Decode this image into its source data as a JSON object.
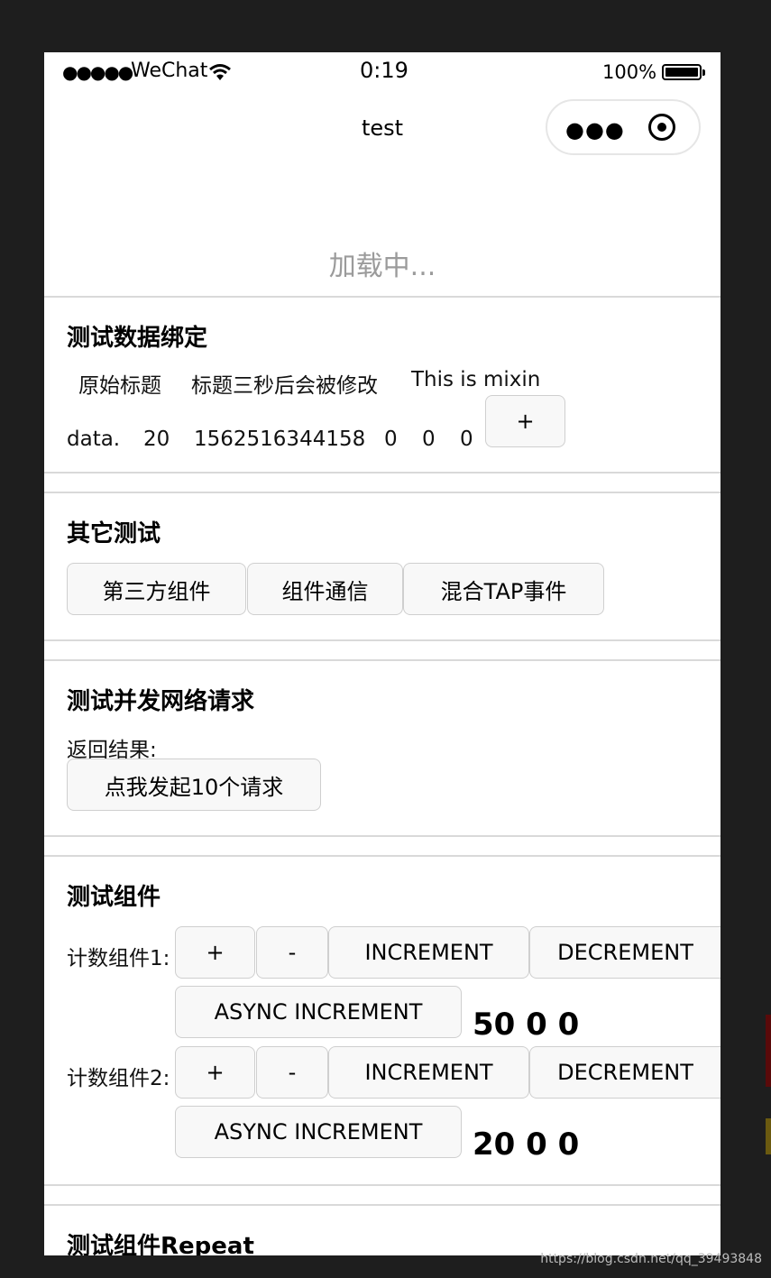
{
  "status_bar": {
    "signal": "●●●●●",
    "carrier": "WeChat",
    "time": "0:19",
    "battery": "100%"
  },
  "nav": {
    "title": "test"
  },
  "loading": {
    "text": "加载中..."
  },
  "section_binding": {
    "title": "测试数据绑定",
    "labels": [
      "原始标题",
      "标题三秒后会被修改",
      "This is mixin"
    ],
    "values": [
      "data.",
      "20",
      "1562516344158",
      "0",
      "0",
      "0"
    ],
    "plus_label": "+"
  },
  "section_other": {
    "title": "其它测试",
    "buttons": [
      "第三方组件",
      "组件通信",
      "混合TAP事件"
    ]
  },
  "section_network": {
    "title": "测试并发网络请求",
    "result_label": "返回结果:",
    "button": "点我发起10个请求"
  },
  "section_component": {
    "title": "测试组件",
    "counters": [
      {
        "label": "计数组件1:",
        "btn_plus": "+",
        "btn_minus": "-",
        "btn_inc": "INCREMENT",
        "btn_dec": "DECREMENT",
        "btn_async": "ASYNC INCREMENT",
        "value": "50 0 0"
      },
      {
        "label": "计数组件2:",
        "btn_plus": "+",
        "btn_minus": "-",
        "btn_inc": "INCREMENT",
        "btn_dec": "DECREMENT",
        "btn_async": "ASYNC INCREMENT",
        "value": "20 0 0"
      }
    ]
  },
  "section_repeat": {
    "title": "测试组件Repeat"
  },
  "watermark": "https://blog.csdn.net/qq_39493848",
  "colors": {
    "page_background": "#1e1e1e",
    "button_background": "#f8f8f8",
    "divider": "#d9d9d9",
    "loading_text": "#9b9b9b"
  }
}
